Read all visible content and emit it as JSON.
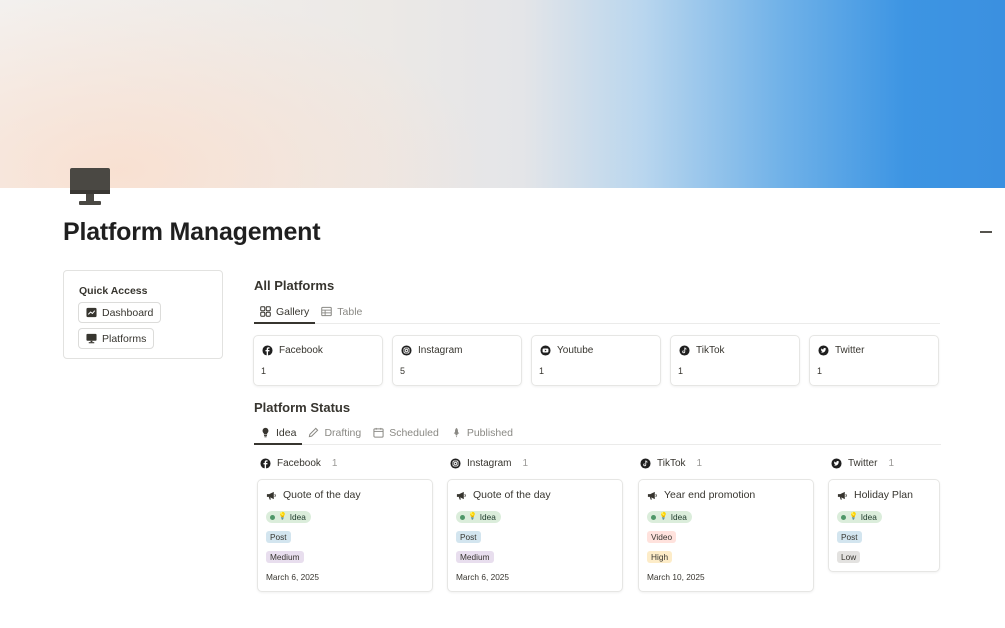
{
  "page": {
    "title": "Platform Management"
  },
  "quick_access": {
    "title": "Quick Access",
    "buttons": [
      {
        "label": "Dashboard",
        "icon": "dashboard-icon"
      },
      {
        "label": "Platforms",
        "icon": "monitor-icon"
      }
    ]
  },
  "all_platforms": {
    "title": "All Platforms",
    "tabs": [
      {
        "label": "Gallery",
        "icon": "gallery-icon",
        "active": true
      },
      {
        "label": "Table",
        "icon": "table-icon",
        "active": false
      }
    ],
    "cards": [
      {
        "name": "Facebook",
        "icon": "facebook-icon",
        "count": "1"
      },
      {
        "name": "Instagram",
        "icon": "instagram-icon",
        "count": "5"
      },
      {
        "name": "Youtube",
        "icon": "youtube-icon",
        "count": "1"
      },
      {
        "name": "TikTok",
        "icon": "tiktok-icon",
        "count": "1"
      },
      {
        "name": "Twitter",
        "icon": "twitter-icon",
        "count": "1"
      }
    ]
  },
  "platform_status": {
    "title": "Platform Status",
    "tabs": [
      {
        "label": "Idea",
        "icon": "lightbulb-icon",
        "active": true
      },
      {
        "label": "Drafting",
        "icon": "pencil-icon",
        "active": false
      },
      {
        "label": "Scheduled",
        "icon": "calendar-icon",
        "active": false
      },
      {
        "label": "Published",
        "icon": "published-icon",
        "active": false
      }
    ],
    "columns": [
      {
        "platform": "Facebook",
        "icon": "facebook-icon",
        "count": "1",
        "card": {
          "title": "Quote of the day",
          "status": "Idea",
          "type": "Post",
          "priority": "Medium",
          "date": "March 6, 2025"
        }
      },
      {
        "platform": "Instagram",
        "icon": "instagram-icon",
        "count": "1",
        "card": {
          "title": "Quote of the day",
          "status": "Idea",
          "type": "Post",
          "priority": "Medium",
          "date": "March 6, 2025"
        }
      },
      {
        "platform": "TikTok",
        "icon": "tiktok-icon",
        "count": "1",
        "card": {
          "title": "Year end promotion",
          "status": "Idea",
          "type": "Video",
          "priority": "High",
          "date": "March 10, 2025"
        }
      },
      {
        "platform": "Twitter",
        "icon": "twitter-icon",
        "count": "1",
        "card": {
          "title": "Holiday Plan",
          "status": "Idea",
          "type": "Post",
          "priority": "Low",
          "date": ""
        }
      }
    ]
  },
  "colors": {
    "text": "#37352f",
    "muted": "#8a8984",
    "idea_bg": "#dbeddb",
    "post_bg": "#d3e5ef",
    "video_bg": "#ffe2dd",
    "medium_bg": "#e8deee",
    "high_bg": "#fdecc8",
    "low_bg": "#e3e2e0",
    "cover_start": "#f3f1ef",
    "cover_end": "#3b90e0"
  }
}
